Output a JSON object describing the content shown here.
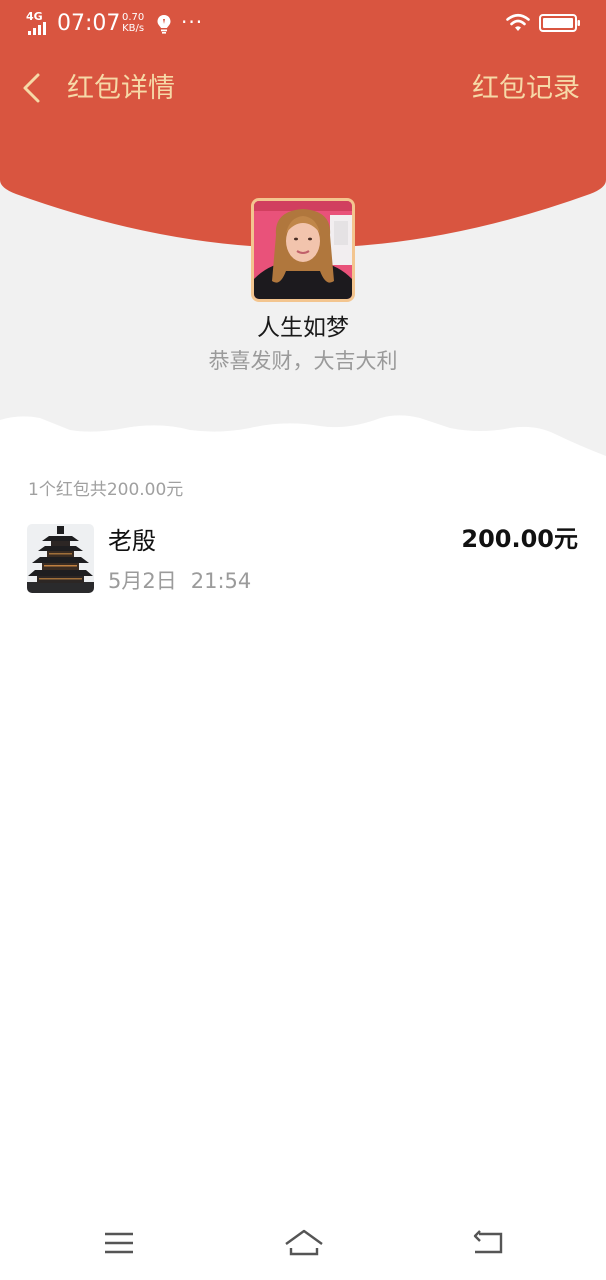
{
  "status_bar": {
    "network": "4G",
    "time": "07:07",
    "speed_value": "0.70",
    "speed_unit": "KB/s",
    "more": "···"
  },
  "nav": {
    "title": "红包详情",
    "record_link": "红包记录"
  },
  "sender": {
    "name": "人生如梦",
    "wish": "恭喜发财，大吉大利"
  },
  "summary": "1个红包共200.00元",
  "receivers": [
    {
      "name": "老殷",
      "date": "5月2日",
      "time": "21:54",
      "amount": "200.00元"
    }
  ],
  "colors": {
    "header_red": "#d95540",
    "gold_text": "#f6d9a7",
    "avatar_border": "#f3c58f",
    "grey_band": "#f1f1f1"
  },
  "icons": {
    "back": "chevron-left-icon",
    "wifi": "wifi-icon",
    "battery": "battery-icon",
    "menu": "menu-icon",
    "home": "home-icon",
    "return": "return-icon"
  }
}
